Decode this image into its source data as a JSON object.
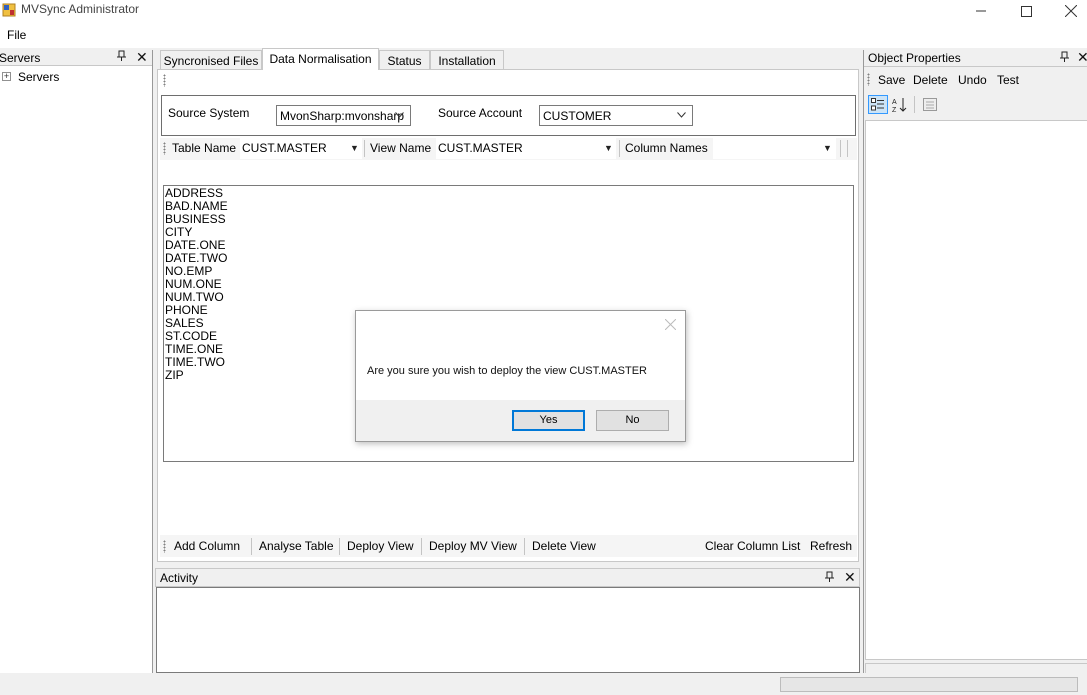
{
  "window": {
    "title": "MVSync Administrator"
  },
  "menu": {
    "file": "File"
  },
  "servers_panel": {
    "title": "Servers",
    "tree_root": "Servers",
    "expander": "+"
  },
  "tabs": [
    {
      "label": "Syncronised Files"
    },
    {
      "label": "Data Normalisation",
      "active": true
    },
    {
      "label": "Status"
    },
    {
      "label": "Installation"
    }
  ],
  "source": {
    "system_label": "Source System",
    "system_value": "MvonSharp:mvonsharp",
    "account_label": "Source Account",
    "account_value": "CUSTOMER"
  },
  "view_toolbar": {
    "table_label": "Table Name",
    "table_value": "CUST.MASTER",
    "view_label": "View Name",
    "view_value": "CUST.MASTER",
    "columns_label": "Column Names",
    "columns_value": ""
  },
  "columns": [
    "ADDRESS",
    "BAD.NAME",
    "BUSINESS",
    "CITY",
    "DATE.ONE",
    "DATE.TWO",
    "NO.EMP",
    "NUM.ONE",
    "NUM.TWO",
    "PHONE",
    "SALES",
    "ST.CODE",
    "TIME.ONE",
    "TIME.TWO",
    "ZIP"
  ],
  "actions": {
    "add_column": "Add Column",
    "analyse_table": "Analyse Table",
    "deploy_view": "Deploy View",
    "deploy_mv_view": "Deploy MV View",
    "delete_view": "Delete View",
    "clear_column_list": "Clear Column List",
    "refresh": "Refresh"
  },
  "activity": {
    "title": "Activity"
  },
  "properties": {
    "title": "Object Properties",
    "save": "Save",
    "delete": "Delete",
    "undo": "Undo",
    "test": "Test"
  },
  "dialog": {
    "message": "Are you sure you wish to deploy the view CUST.MASTER",
    "yes": "Yes",
    "no": "No"
  },
  "colors": {
    "accent": "#0078d7",
    "window_bg": "#f0f0f0"
  }
}
